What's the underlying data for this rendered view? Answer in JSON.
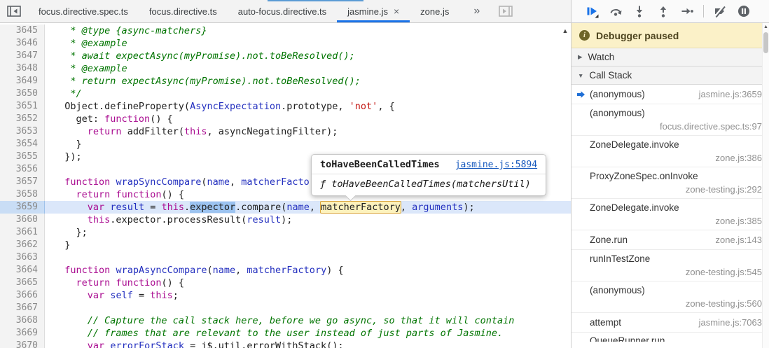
{
  "colors": {
    "accent_blue": "#1a73e8",
    "paused_banner_bg": "#fbf1c8",
    "execution_line_bg": "#dbe7fa",
    "selection_highlight_bg": "#9cc3f0",
    "eval_highlight_bg": "#fdf2bd",
    "eval_highlight_border": "#dba63c",
    "keyword_color": "#aa0d91",
    "string_color": "#c41a16",
    "comment_color": "#007400",
    "variable_color": "#2430bf"
  },
  "icons": {
    "close": "×",
    "overflow_chevron": "»",
    "scroll_up": "▲",
    "chevron_collapsed": "▶",
    "chevron_expanded": "▼"
  },
  "tabbar": {
    "overflow_label": "»",
    "tabs": [
      {
        "label": "focus.directive.spec.ts",
        "active": false,
        "closable": false
      },
      {
        "label": "focus.directive.ts",
        "active": false,
        "closable": false
      },
      {
        "label": "auto-focus.directive.ts",
        "active": false,
        "closable": false
      },
      {
        "label": "jasmine.js",
        "active": true,
        "closable": true
      },
      {
        "label": "zone.js",
        "active": false,
        "closable": false
      }
    ]
  },
  "tooltip": {
    "title": "toHaveBeenCalledTimes",
    "link": "jasmine.js:5894",
    "signature": "ƒ toHaveBeenCalledTimes(matchersUtil)"
  },
  "editor": {
    "lines": [
      {
        "n": 3645,
        "t": [
          [
            "c",
            "   * @type {async-matchers}"
          ]
        ]
      },
      {
        "n": 3646,
        "t": [
          [
            "c",
            "   * @example"
          ]
        ]
      },
      {
        "n": 3647,
        "t": [
          [
            "c",
            "   * await expectAsync(myPromise).not.toBeResolved();"
          ]
        ]
      },
      {
        "n": 3648,
        "t": [
          [
            "c",
            "   * @example"
          ]
        ]
      },
      {
        "n": 3649,
        "t": [
          [
            "c",
            "   * return expectAsync(myPromise).not.toBeResolved();"
          ]
        ]
      },
      {
        "n": 3650,
        "t": [
          [
            "c",
            "   */"
          ]
        ]
      },
      {
        "n": 3651,
        "t": [
          [
            "p",
            "  Object.defineProperty("
          ],
          [
            "v",
            "AsyncExpectation"
          ],
          [
            "p",
            ".prototype, "
          ],
          [
            "s",
            "'not'"
          ],
          [
            "p",
            ", {"
          ]
        ]
      },
      {
        "n": 3652,
        "t": [
          [
            "p",
            "    get: "
          ],
          [
            "k",
            "function"
          ],
          [
            "p",
            "() {"
          ]
        ]
      },
      {
        "n": 3653,
        "t": [
          [
            "p",
            "      "
          ],
          [
            "k",
            "return"
          ],
          [
            "p",
            " addFilter("
          ],
          [
            "k",
            "this"
          ],
          [
            "p",
            ", asyncNegatingFilter);"
          ]
        ]
      },
      {
        "n": 3654,
        "t": [
          [
            "p",
            "    }"
          ]
        ]
      },
      {
        "n": 3655,
        "t": [
          [
            "p",
            "  });"
          ]
        ]
      },
      {
        "n": 3656,
        "t": []
      },
      {
        "n": 3657,
        "t": [
          [
            "p",
            "  "
          ],
          [
            "k",
            "function"
          ],
          [
            "p",
            " "
          ],
          [
            "v",
            "wrapSyncCompare"
          ],
          [
            "p",
            "("
          ],
          [
            "v",
            "name"
          ],
          [
            "p",
            ", "
          ],
          [
            "v",
            "matcherFactory"
          ],
          [
            "p",
            ") {"
          ]
        ]
      },
      {
        "n": 3658,
        "t": [
          [
            "p",
            "    "
          ],
          [
            "k",
            "return"
          ],
          [
            "p",
            " "
          ],
          [
            "k",
            "function"
          ],
          [
            "p",
            "() {"
          ]
        ]
      },
      {
        "n": 3659,
        "cur": true,
        "t": [
          [
            "p",
            "      "
          ],
          [
            "k",
            "var"
          ],
          [
            "p",
            " "
          ],
          [
            "v",
            "result"
          ],
          [
            "p",
            " = "
          ],
          [
            "k",
            "this"
          ],
          [
            "p",
            "."
          ],
          [
            "sel",
            "expector"
          ],
          [
            "p",
            ".compare("
          ],
          [
            "v",
            "name"
          ],
          [
            "p",
            ", "
          ],
          [
            "eval",
            "matcherFactory"
          ],
          [
            "p",
            ", "
          ],
          [
            "v",
            "arguments"
          ],
          [
            "p",
            ");"
          ]
        ]
      },
      {
        "n": 3660,
        "t": [
          [
            "p",
            "      "
          ],
          [
            "k",
            "this"
          ],
          [
            "p",
            ".expector.processResult("
          ],
          [
            "v",
            "result"
          ],
          [
            "p",
            ");"
          ]
        ]
      },
      {
        "n": 3661,
        "t": [
          [
            "p",
            "    };"
          ]
        ]
      },
      {
        "n": 3662,
        "t": [
          [
            "p",
            "  }"
          ]
        ]
      },
      {
        "n": 3663,
        "t": []
      },
      {
        "n": 3664,
        "t": [
          [
            "p",
            "  "
          ],
          [
            "k",
            "function"
          ],
          [
            "p",
            " "
          ],
          [
            "v",
            "wrapAsyncCompare"
          ],
          [
            "p",
            "("
          ],
          [
            "v",
            "name"
          ],
          [
            "p",
            ", "
          ],
          [
            "v",
            "matcherFactory"
          ],
          [
            "p",
            ") {"
          ]
        ]
      },
      {
        "n": 3665,
        "t": [
          [
            "p",
            "    "
          ],
          [
            "k",
            "return"
          ],
          [
            "p",
            " "
          ],
          [
            "k",
            "function"
          ],
          [
            "p",
            "() {"
          ]
        ]
      },
      {
        "n": 3666,
        "t": [
          [
            "p",
            "      "
          ],
          [
            "k",
            "var"
          ],
          [
            "p",
            " "
          ],
          [
            "v",
            "self"
          ],
          [
            "p",
            " = "
          ],
          [
            "k",
            "this"
          ],
          [
            "p",
            ";"
          ]
        ]
      },
      {
        "n": 3667,
        "t": []
      },
      {
        "n": 3668,
        "t": [
          [
            "c",
            "      // Capture the call stack here, before we go async, so that it will contain"
          ]
        ]
      },
      {
        "n": 3669,
        "t": [
          [
            "c",
            "      // frames that are relevant to the user instead of just parts of Jasmine."
          ]
        ]
      },
      {
        "n": 3670,
        "t": [
          [
            "p",
            "      "
          ],
          [
            "k",
            "var"
          ],
          [
            "p",
            " "
          ],
          [
            "v",
            "errorForStack"
          ],
          [
            "p",
            " = j$.util.errorWithStack();"
          ]
        ]
      }
    ]
  },
  "sidebar": {
    "banner": {
      "icon_glyph": "i",
      "text": "Debugger paused"
    },
    "watch": {
      "title": "Watch"
    },
    "call_stack": {
      "title": "Call Stack",
      "frames": [
        {
          "name": "(anonymous)",
          "location": "jasmine.js:3659",
          "current": true,
          "wrap": false
        },
        {
          "name": "(anonymous)",
          "location": "focus.directive.spec.ts:97",
          "wrap": true
        },
        {
          "name": "ZoneDelegate.invoke",
          "location": "zone.js:386",
          "wrap": true
        },
        {
          "name": "ProxyZoneSpec.onInvoke",
          "location": "zone-testing.js:292",
          "wrap": true
        },
        {
          "name": "ZoneDelegate.invoke",
          "location": "zone.js:385",
          "wrap": true
        },
        {
          "name": "Zone.run",
          "location": "zone.js:143",
          "wrap": false
        },
        {
          "name": "runInTestZone",
          "location": "zone-testing.js:545",
          "wrap": true
        },
        {
          "name": "(anonymous)",
          "location": "zone-testing.js:560",
          "wrap": true
        },
        {
          "name": "attempt",
          "location": "jasmine.js:7063",
          "wrap": false
        },
        {
          "name": "QueueRunner.run",
          "location": "",
          "wrap": false,
          "partial": true
        }
      ]
    }
  }
}
